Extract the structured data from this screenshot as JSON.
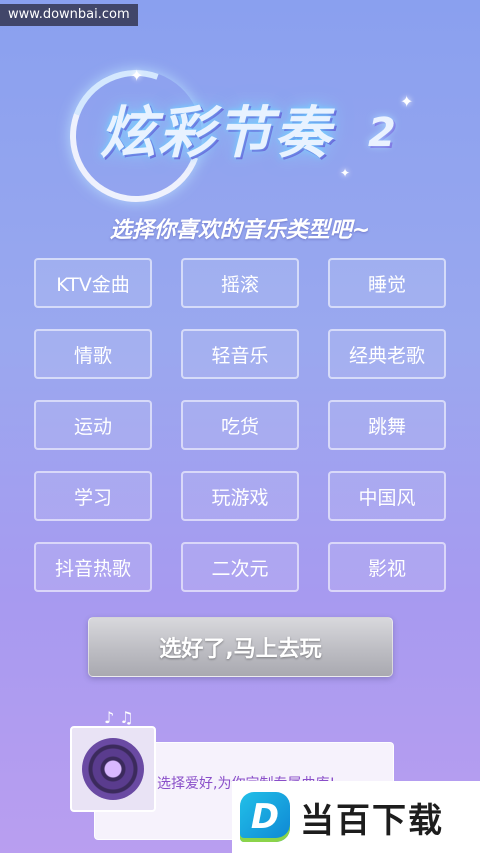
{
  "watermark": {
    "site": "www.downbai.com"
  },
  "header": {
    "logo_title": "炫彩节奏",
    "logo_suffix": "2",
    "subtitle": "选择你喜欢的音乐类型吧~"
  },
  "genres": [
    {
      "label": "KTV金曲"
    },
    {
      "label": "摇滚"
    },
    {
      "label": "睡觉"
    },
    {
      "label": "情歌"
    },
    {
      "label": "轻音乐"
    },
    {
      "label": "经典老歌"
    },
    {
      "label": "运动"
    },
    {
      "label": "吃货"
    },
    {
      "label": "跳舞"
    },
    {
      "label": "学习"
    },
    {
      "label": "玩游戏"
    },
    {
      "label": "中国风"
    },
    {
      "label": "抖音热歌"
    },
    {
      "label": "二次元"
    },
    {
      "label": "影视"
    }
  ],
  "confirm": {
    "label": "选好了,马上去玩"
  },
  "promo": {
    "text": "选择爱好,为你定制专属曲库!",
    "icon": "vinyl-record-icon",
    "notes": "♪ ♫"
  },
  "bottom_watermark": {
    "brand": "当百下载",
    "icon_letter": "D"
  },
  "colors": {
    "bg_top": "#8aa0ef",
    "bg_bottom": "#b99ef0",
    "promo_text": "#8a4fc9",
    "brand_blue": "#0e86d4"
  }
}
